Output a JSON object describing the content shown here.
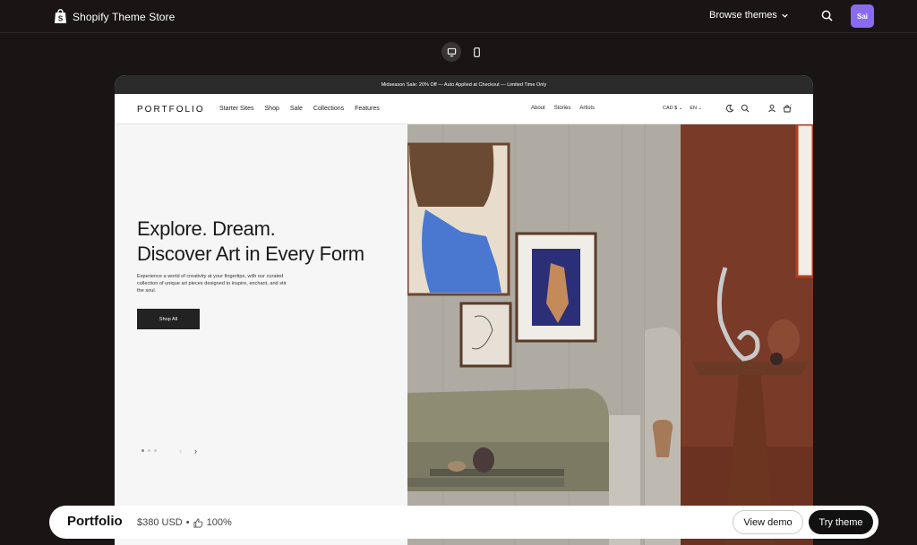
{
  "store": {
    "title": "Shopify Theme Store",
    "browse_label": "Browse themes",
    "avatar_initials": "Sai"
  },
  "preview": {
    "announcement": "Midseason Sale: 20% Off — Auto Applied at Checkout — Limited Time Only",
    "brand": "PORTFOLIO",
    "nav_links": [
      "Starter Sites",
      "Shop",
      "Sale",
      "Collections",
      "Features"
    ],
    "nav_links_right": [
      "About",
      "Stories",
      "Artists"
    ],
    "currency": "CAD $",
    "language": "EN",
    "headline_line1": "Explore. Dream.",
    "headline_line2": "Discover Art in Every Form",
    "subtext": "Experience a world of creativity at your fingertips, with our curated collection of unique art pieces designed to inspire, enchant, and stir the soul.",
    "cta": "Shop All",
    "cart_count": "0"
  },
  "bottom": {
    "theme_name": "Portfolio",
    "price": "$380 USD",
    "separator": "•",
    "rating": "100%",
    "view_demo": "View demo",
    "try_theme": "Try theme"
  },
  "colors": {
    "page_bg": "#1a1414",
    "avatar": "#8a6bf0",
    "wall_right": "#7a3a28"
  }
}
